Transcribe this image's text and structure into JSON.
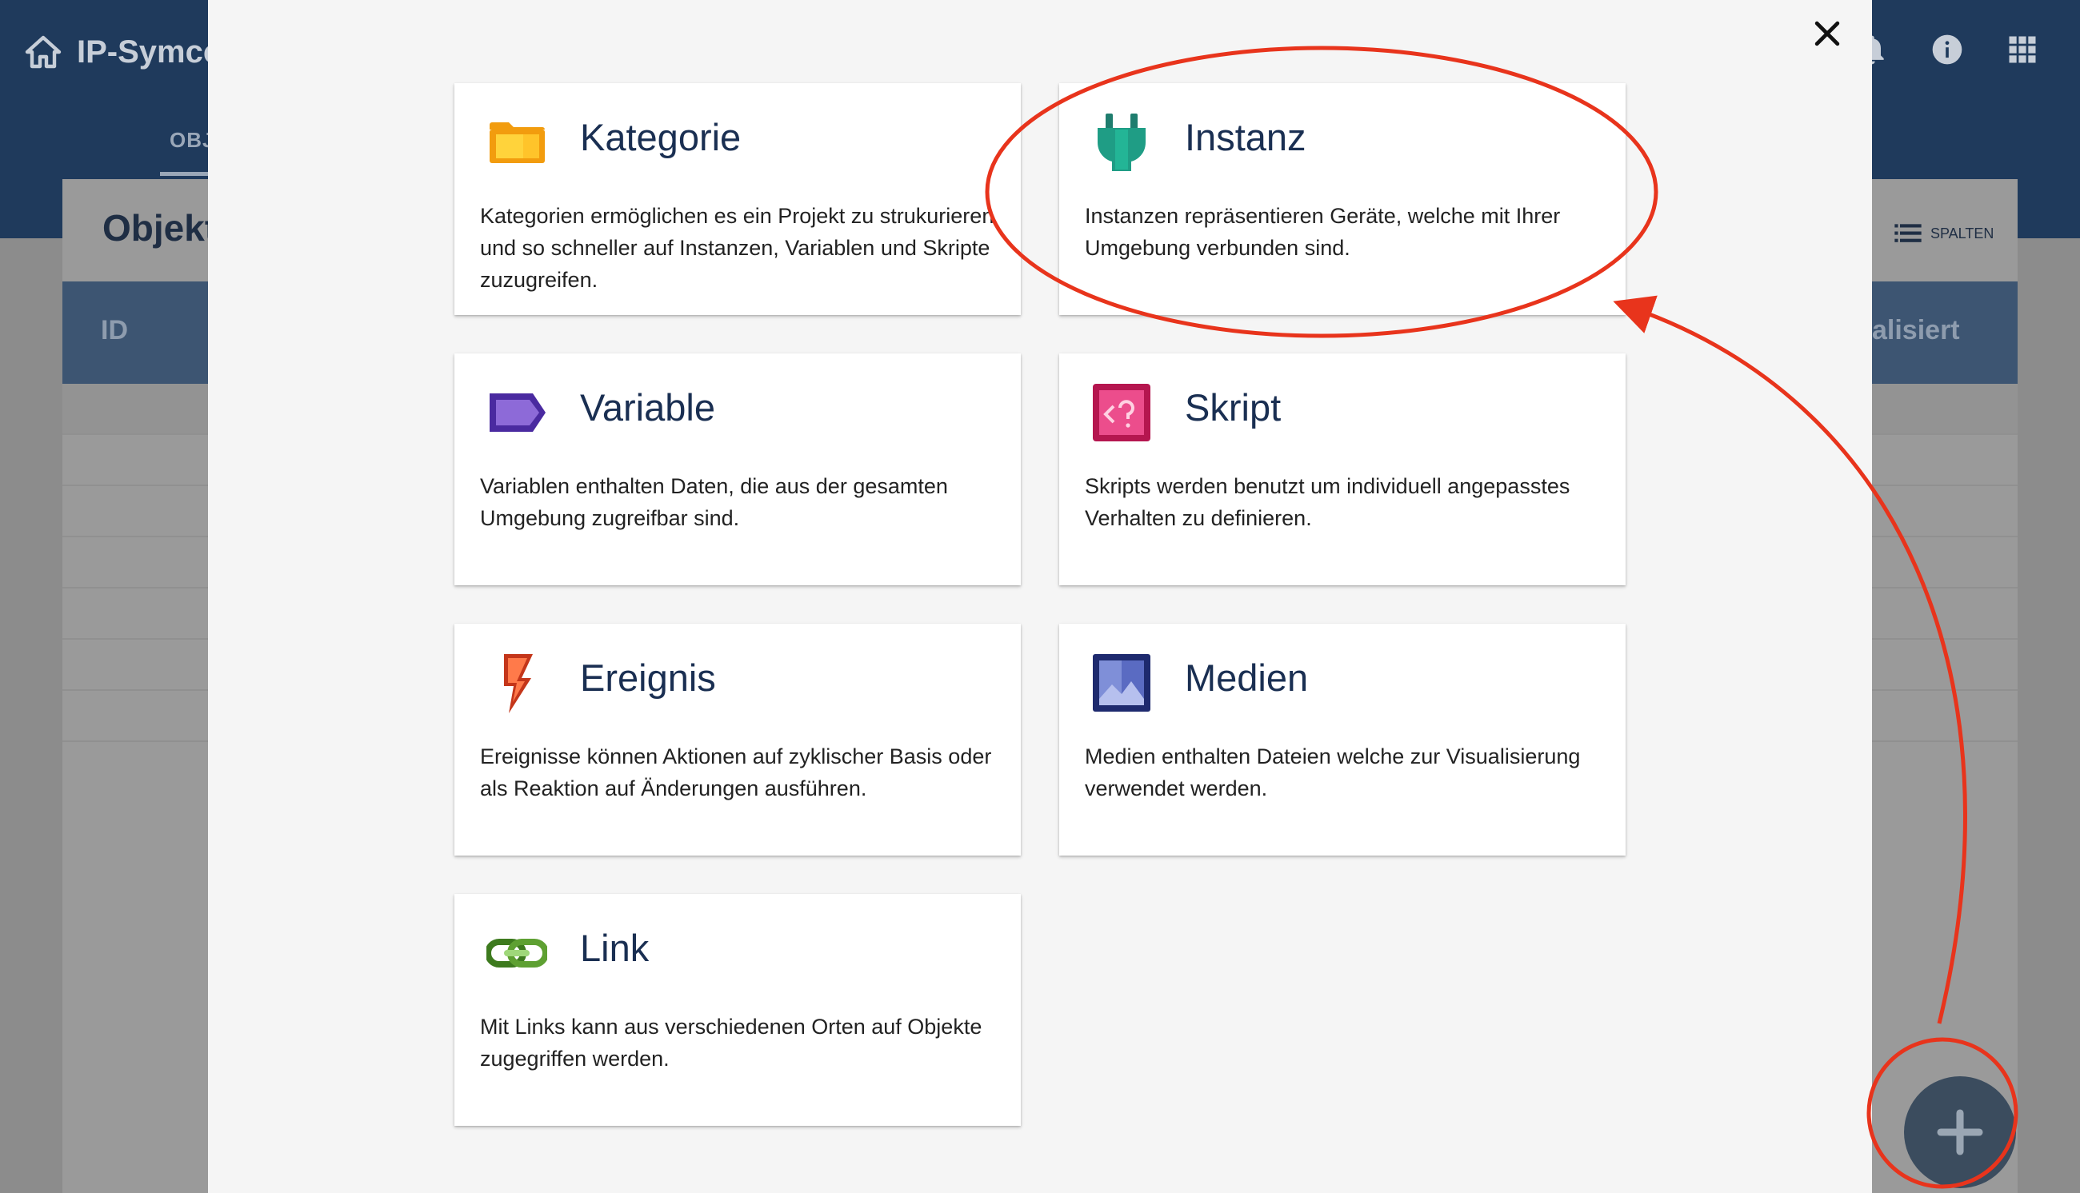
{
  "app": {
    "brand": "IP-Symco",
    "tab_objects": "OBJ",
    "page_title": "Objekt",
    "columns_label": "SPALTEN",
    "header_id": "ID",
    "header_right": "alisiert"
  },
  "colors": {
    "topbar": "#1f3a5c",
    "modal_bg": "#f5f5f5",
    "tile_title": "#1a2f52",
    "annotation": "#e8341c",
    "fab": "#3b4c5e"
  },
  "modal": {
    "tiles": [
      {
        "title": "Kategorie",
        "icon": "folder-icon",
        "description": "Kategorien ermöglichen es ein Projekt zu strukurieren und so schneller auf Instanzen, Variablen und Skripte zuzugreifen."
      },
      {
        "title": "Instanz",
        "icon": "plug-icon",
        "description": "Instanzen repräsentieren Geräte, welche mit Ihrer Umgebung verbunden sind."
      },
      {
        "title": "Variable",
        "icon": "tag-icon",
        "description": "Variablen enthalten Daten, die aus der gesamten Umgebung zugreifbar sind."
      },
      {
        "title": "Skript",
        "icon": "script-icon",
        "description": "Skripts werden benutzt um individuell angepasstes Verhalten zu definieren."
      },
      {
        "title": "Ereignis",
        "icon": "lightning-icon",
        "description": "Ereignisse können Aktionen auf zyklischer Basis oder als Reaktion auf Änderungen ausführen."
      },
      {
        "title": "Medien",
        "icon": "image-icon",
        "description": "Medien enthalten Dateien welche zur Visualisierung verwendet werden."
      },
      {
        "title": "Link",
        "icon": "link-icon",
        "description": "Mit Links kann aus verschiedenen Orten auf Objekte zugegriffen werden."
      }
    ]
  }
}
